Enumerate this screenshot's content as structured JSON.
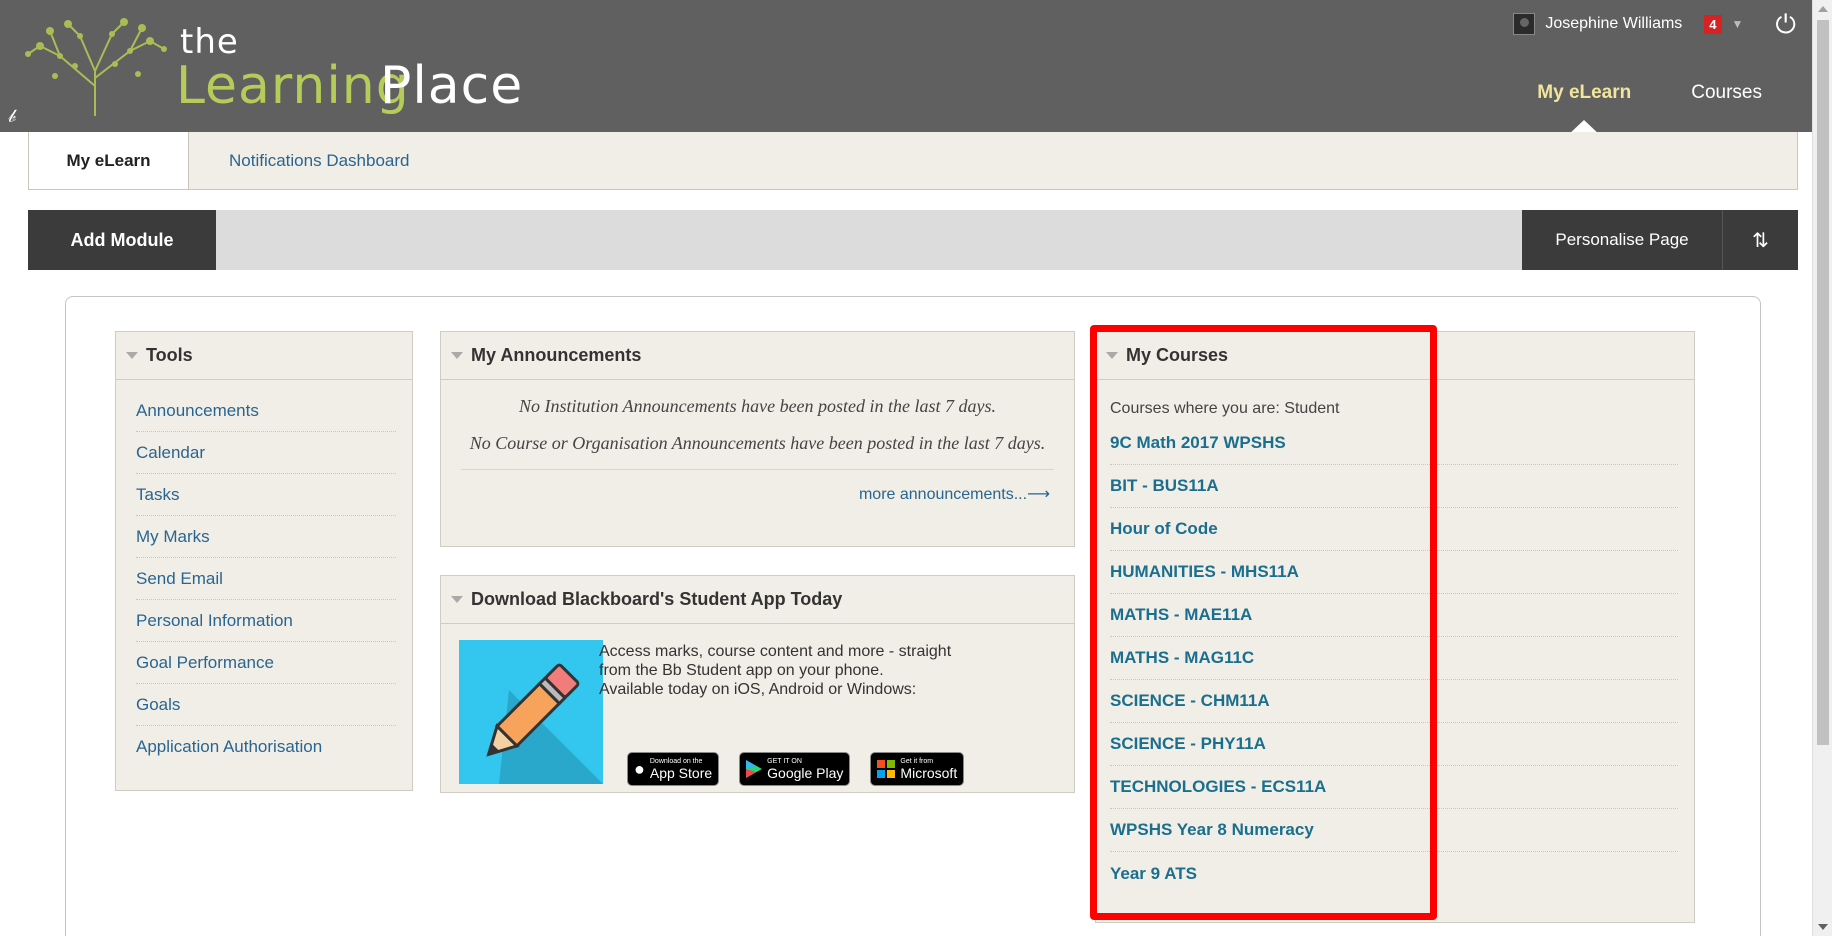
{
  "header": {
    "logo_the": "the",
    "logo_learning": "Learning",
    "logo_place": "Place",
    "user_name": "Josephine Williams",
    "notification_count": "4",
    "brand_color": "#b5cc5a",
    "header_bg": "#606060"
  },
  "top_nav": {
    "tabs": [
      {
        "label": "My eLearn",
        "active": true
      },
      {
        "label": "Courses",
        "active": false
      }
    ]
  },
  "sub_nav": {
    "tabs": [
      {
        "label": "My eLearn",
        "active": true
      },
      {
        "label": "Notifications Dashboard",
        "active": false
      }
    ]
  },
  "action_bar": {
    "add_module": "Add Module",
    "personalise": "Personalise Page",
    "reorder_icon": "reorder-arrows-icon"
  },
  "tools": {
    "title": "Tools",
    "items": [
      "Announcements",
      "Calendar",
      "Tasks",
      "My Marks",
      "Send Email",
      "Personal Information",
      "Goal Performance",
      "Goals",
      "Application Authorisation"
    ]
  },
  "announcements": {
    "title": "My Announcements",
    "institution_msg": "No Institution Announcements have been posted in the last 7 days.",
    "course_msg": "No Course or Organisation Announcements have been posted in the last 7 days.",
    "more_link": "more announcements...⟶"
  },
  "download": {
    "title": "Download Blackboard's Student App Today",
    "line1": "Access marks, course content and more - straight",
    "line2": "from the Bb Student app on your phone.",
    "line3": "Available today on iOS, Android or Windows:",
    "badges": [
      {
        "small": "Download on the",
        "big": "App Store"
      },
      {
        "small": "GET IT ON",
        "big": "Google Play"
      },
      {
        "small": "Get it from",
        "big": "Microsoft"
      }
    ]
  },
  "courses": {
    "title": "My Courses",
    "role_text": "Courses where you are: Student",
    "items": [
      "9C Math 2017 WPSHS",
      "BIT - BUS11A",
      "Hour of Code",
      "HUMANITIES - MHS11A",
      "MATHS - MAE11A",
      "MATHS - MAG11C",
      "SCIENCE - CHM11A",
      "SCIENCE - PHY11A",
      "TECHNOLOGIES - ECS11A",
      "WPSHS Year 8 Numeracy",
      "Year 9 ATS"
    ],
    "link_color": "#1b6f8e",
    "highlight_color": "#ff0000"
  }
}
